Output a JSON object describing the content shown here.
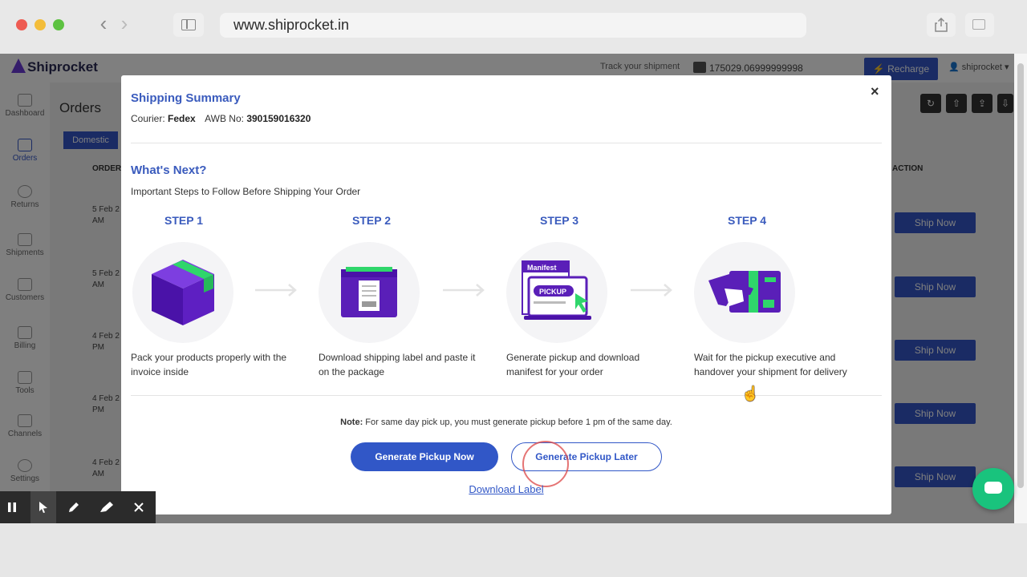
{
  "browser": {
    "url": "www.shiprocket.in",
    "back_glyph": "‹",
    "forward_glyph": "›"
  },
  "app": {
    "logo": "Shiprocket",
    "track_text": "Track your shipment",
    "wallet_balance": "175029.06999999998",
    "recharge_label": "Recharge",
    "account": "shiprocket",
    "page_title": "Orders",
    "tab_domestic": "Domestic",
    "col_order": "ORDER",
    "col_action": "ACTION",
    "nav": [
      {
        "label": "Dashboard",
        "icon": "dashboard-icon"
      },
      {
        "label": "Orders",
        "icon": "orders-icon"
      },
      {
        "label": "Returns",
        "icon": "returns-icon"
      },
      {
        "label": "Shipments",
        "icon": "shipments-icon"
      },
      {
        "label": "Customers",
        "icon": "customers-icon"
      },
      {
        "label": "Billing",
        "icon": "billing-icon"
      },
      {
        "label": "Tools",
        "icon": "tools-icon"
      },
      {
        "label": "Channels",
        "icon": "channels-icon"
      },
      {
        "label": "Settings",
        "icon": "settings-icon"
      }
    ],
    "rows": [
      {
        "date": "5 Feb 2",
        "time": "AM",
        "action": "Ship Now"
      },
      {
        "date": "5 Feb 2",
        "time": "AM",
        "action": "Ship Now"
      },
      {
        "date": "4 Feb 2",
        "time": "PM",
        "action": "Ship Now"
      },
      {
        "date": "4 Feb 2",
        "time": "PM",
        "action": "Ship Now"
      },
      {
        "date": "4 Feb 2",
        "time": "AM",
        "action": "Ship Now"
      }
    ]
  },
  "modal": {
    "title": "Shipping Summary",
    "courier_label": "Courier:",
    "courier_value": "Fedex",
    "awb_label": "AWB No:",
    "awb_value": "390159016320",
    "close_glyph": "×",
    "next_title": "What's Next?",
    "next_subtitle": "Important Steps to Follow Before Shipping Your Order",
    "steps": [
      {
        "label": "STEP 1",
        "desc": "Pack your products properly with the invoice inside",
        "icon": "package-box-icon"
      },
      {
        "label": "STEP 2",
        "desc": "Download shipping label and paste it on the package",
        "icon": "shipping-label-icon"
      },
      {
        "label": "STEP 3",
        "desc": "Generate pickup and download manifest for your order",
        "icon": "pickup-manifest-icon",
        "art_text_1": "Manifest",
        "art_text_2": "PICKUP"
      },
      {
        "label": "STEP 4",
        "desc": "Wait for the pickup executive and handover your shipment for delivery",
        "icon": "handover-package-icon"
      }
    ],
    "note_bold": "Note:",
    "note_text": " For same day pick up, you must generate pickup before 1 pm of the same day.",
    "btn_generate_now": "Generate Pickup Now",
    "btn_generate_later": "Generate Pickup Later",
    "link_download_label": "Download Label"
  },
  "colors": {
    "primary": "#3157c7",
    "heading": "#3a5bbd",
    "accent_purple": "#5a1fb8",
    "accent_green": "#2fd66b"
  }
}
